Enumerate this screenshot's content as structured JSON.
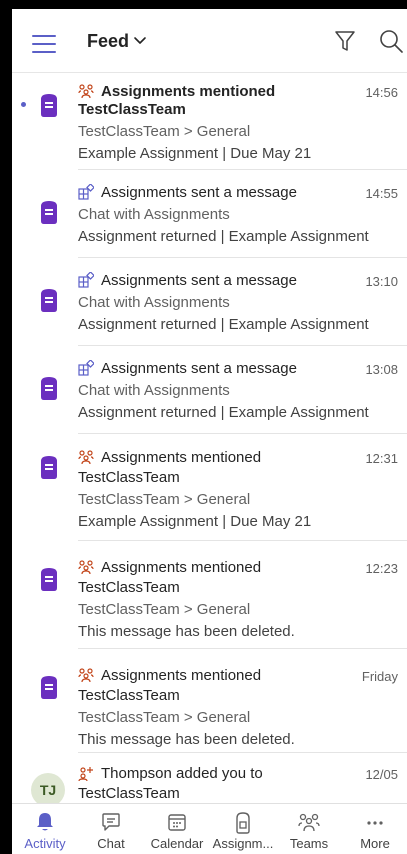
{
  "header": {
    "title": "Feed"
  },
  "colors": {
    "accent": "#5b5fc7",
    "assignments": "#6b2fbf",
    "tj_avatar": "#dfe7d3"
  },
  "feed": [
    {
      "icon": "mention-icon",
      "line1": "Assignments mentioned",
      "line2": "TestClassTeam",
      "sub": "TestClassTeam  > General",
      "body": "Example Assignment | Due May 21",
      "time": "14:56",
      "unread": true
    },
    {
      "icon": "app-message-icon",
      "line1": "Assignments sent a message",
      "sub": "Chat with Assignments",
      "body": "Assignment returned | Example Assignment",
      "time": "14:55"
    },
    {
      "icon": "app-message-icon",
      "line1": "Assignments sent a message",
      "sub": "Chat with Assignments",
      "body": "Assignment returned | Example Assignment",
      "time": "13:10"
    },
    {
      "icon": "app-message-icon",
      "line1": "Assignments sent a message",
      "sub": "Chat with Assignments",
      "body": "Assignment returned | Example Assignment",
      "time": "13:08"
    },
    {
      "icon": "mention-icon",
      "line1": "Assignments mentioned",
      "line2": "TestClassTeam",
      "sub": "TestClassTeam  > General",
      "body": "Example Assignment | Due May 21",
      "time": "12:31"
    },
    {
      "icon": "mention-icon",
      "line1": "Assignments mentioned",
      "line2": "TestClassTeam",
      "sub": "TestClassTeam  > General",
      "body": "This message has been deleted.",
      "time": "12:23"
    },
    {
      "icon": "mention-icon",
      "line1": "Assignments mentioned",
      "line2": "TestClassTeam",
      "sub": "TestClassTeam  > General",
      "body": "This message has been deleted.",
      "time": "Friday"
    },
    {
      "icon": "team-add-icon",
      "avatar": "TJ",
      "line1": "Thompson added you to",
      "line2": "TestClassTeam",
      "time": "12/05"
    }
  ],
  "nav": {
    "activity": "Activity",
    "chat": "Chat",
    "calendar": "Calendar",
    "assignments": "Assignm...",
    "teams": "Teams",
    "more": "More"
  }
}
